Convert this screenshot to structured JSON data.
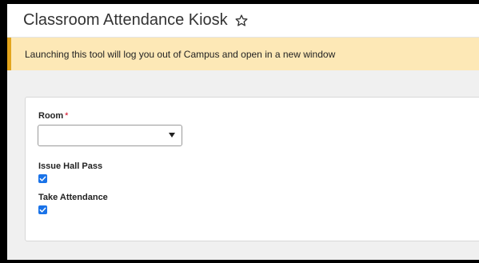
{
  "header": {
    "title": "Classroom Attendance Kiosk",
    "favorite_icon": "star-outline-icon"
  },
  "banner": {
    "message": "Launching this tool will log you out of Campus and open in a new window"
  },
  "form": {
    "room": {
      "label": "Room",
      "required_marker": "*",
      "value": "",
      "dropdown_icon": "caret-down-icon"
    },
    "issue_hall_pass": {
      "label": "Issue Hall Pass",
      "checked": true
    },
    "take_attendance": {
      "label": "Take Attendance",
      "checked": true
    }
  },
  "colors": {
    "banner_bg": "#fde8b6",
    "banner_accent": "#e3a51d",
    "checkbox": "#1a73e8",
    "required": "#d0021b",
    "page_bg": "#f0f0f0"
  }
}
